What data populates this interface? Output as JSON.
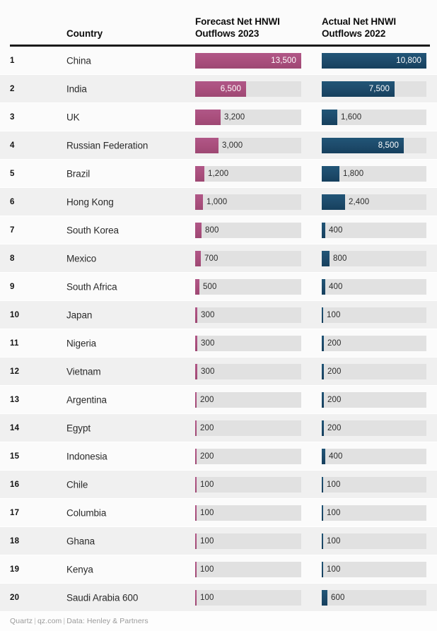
{
  "header": {
    "rank_label": "",
    "country_label": "Country",
    "forecast_label": "Forecast Net HNWI Outflows 2023",
    "actual_label": "Actual Net HNWI Outflows 2022"
  },
  "footer": {
    "source": "Quartz",
    "site": "qz.com",
    "data_credit": "Data: Henley & Partners",
    "separator": "|"
  },
  "colors": {
    "forecast_bar": "#a94e7c",
    "actual_bar": "#1d4a6a",
    "track": "#e1e1e1",
    "row_odd": "#fbfbfb",
    "row_even": "#f0f0f0",
    "header_rule": "#1a1a1a",
    "label_inside": "#ffffff",
    "label_outside": "#2b2b2b"
  },
  "chart_data": {
    "type": "bar",
    "title": "",
    "orientation": "horizontal",
    "grid": false,
    "legend": "none",
    "categories": [
      "China",
      "India",
      "UK",
      "Russian Federation",
      "Brazil",
      "Hong Kong",
      "South Korea",
      "Mexico",
      "South Africa",
      "Japan",
      "Nigeria",
      "Vietnam",
      "Argentina",
      "Egypt",
      "Indonesia",
      "Chile",
      "Columbia",
      "Ghana",
      "Kenya",
      "Saudi Arabia 600"
    ],
    "ranks": [
      1,
      2,
      3,
      4,
      5,
      6,
      7,
      8,
      9,
      10,
      11,
      12,
      13,
      14,
      15,
      16,
      17,
      18,
      19,
      20
    ],
    "series": [
      {
        "name": "Forecast Net HNWI Outflows 2023",
        "key": "forecast",
        "color": "#a94e7c",
        "max": 13500,
        "values": [
          13500,
          6500,
          3200,
          3000,
          1200,
          1000,
          800,
          700,
          500,
          300,
          300,
          300,
          200,
          200,
          200,
          100,
          100,
          100,
          100,
          100
        ],
        "labels": [
          "13,500",
          "6,500",
          "3,200",
          "3,000",
          "1,200",
          "1,000",
          "800",
          "700",
          "500",
          "300",
          "300",
          "300",
          "200",
          "200",
          "200",
          "100",
          "100",
          "100",
          "100",
          "100"
        ]
      },
      {
        "name": "Actual Net HNWI Outflows 2022",
        "key": "actual",
        "color": "#1d4a6a",
        "max": 10800,
        "values": [
          10800,
          7500,
          1600,
          8500,
          1800,
          2400,
          400,
          800,
          400,
          100,
          200,
          200,
          200,
          200,
          400,
          100,
          100,
          100,
          100,
          600
        ],
        "labels": [
          "10,800",
          "7,500",
          "1,600",
          "8,500",
          "1,800",
          "2,400",
          "400",
          "800",
          "400",
          "100",
          "200",
          "200",
          "200",
          "200",
          "400",
          "100",
          "100",
          "100",
          "100",
          "600"
        ]
      }
    ],
    "xlabel": "",
    "ylabel": "",
    "xlim": [
      0,
      13500
    ]
  }
}
